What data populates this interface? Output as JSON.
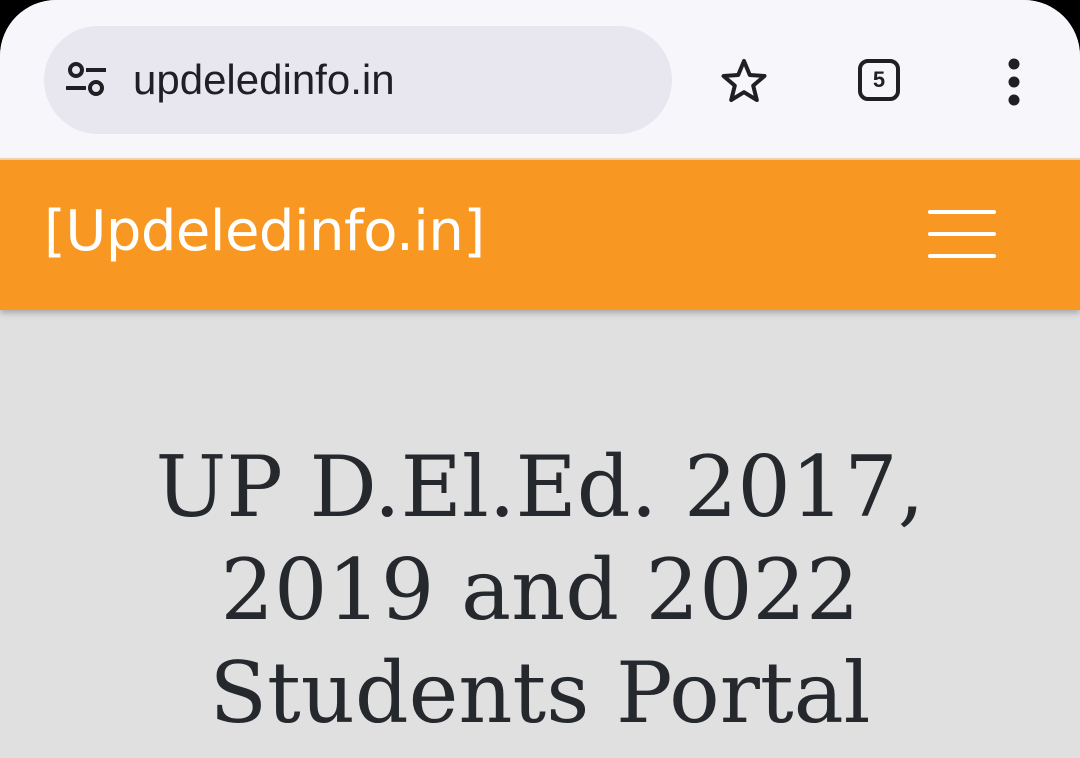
{
  "browser": {
    "url": "updeledinfo.in",
    "tab_count": "5",
    "icons": {
      "site_info": "tune-icon",
      "bookmark": "star-outline-icon",
      "tabs": "tab-switcher-icon",
      "menu": "more-vert-icon"
    }
  },
  "site": {
    "logo": "[Updeledinfo.in]",
    "menu_icon": "hamburger-menu-icon",
    "header_color": "#f89822"
  },
  "hero": {
    "title_lines": [
      "UP D.El.Ed. 2017,",
      "2019 and 2022",
      "Students Portal"
    ]
  }
}
